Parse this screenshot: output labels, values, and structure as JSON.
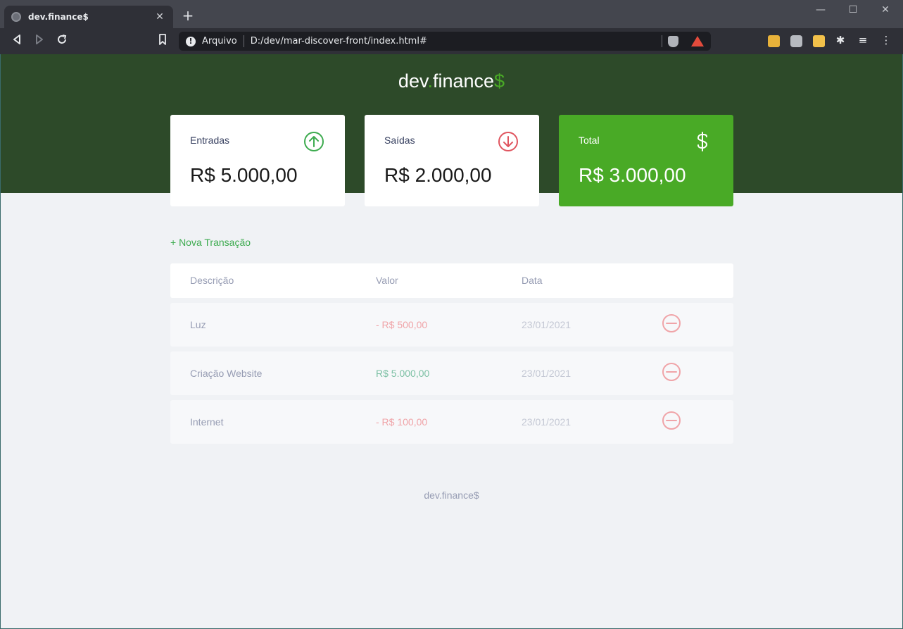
{
  "browser": {
    "tab_title": "dev.finance$",
    "tab_close": "✕",
    "new_tab": "+",
    "window_controls": {
      "minimize": "—",
      "maximize": "☐",
      "close": "✕"
    },
    "omnibox": {
      "scheme_label": "Arquivo",
      "url": "D:/dev/mar-discover-front/index.html#"
    }
  },
  "app": {
    "logo": {
      "prefix": "dev",
      "dot": ".",
      "name": "finance",
      "suffix": "$"
    },
    "cards": {
      "income": {
        "label": "Entradas",
        "value": "R$ 5.000,00",
        "icon": "arrow-up-circle-icon",
        "color": "#3dab4f"
      },
      "expense": {
        "label": "Saídas",
        "value": "R$ 2.000,00",
        "icon": "arrow-down-circle-icon",
        "color": "#e0555f"
      },
      "total": {
        "label": "Total",
        "value": "R$ 3.000,00",
        "icon": "dollar-icon",
        "color": "#49aa26"
      }
    },
    "new_transaction_label": "+ Nova Transação",
    "table": {
      "headers": {
        "description": "Descrição",
        "amount": "Valor",
        "date": "Data"
      },
      "rows": [
        {
          "description": "Luz",
          "amount": "- R$ 500,00",
          "date": "23/01/2021",
          "type": "expense"
        },
        {
          "description": "Criação Website",
          "amount": "R$ 5.000,00",
          "date": "23/01/2021",
          "type": "income"
        },
        {
          "description": "Internet",
          "amount": "- R$ 100,00",
          "date": "23/01/2021",
          "type": "expense"
        }
      ]
    },
    "footer": "dev.finance$"
  },
  "colors": {
    "header_bg": "#2d4a29",
    "accent_green": "#49aa26",
    "expense_red": "#e0555f",
    "page_bg": "#f0f2f5"
  }
}
